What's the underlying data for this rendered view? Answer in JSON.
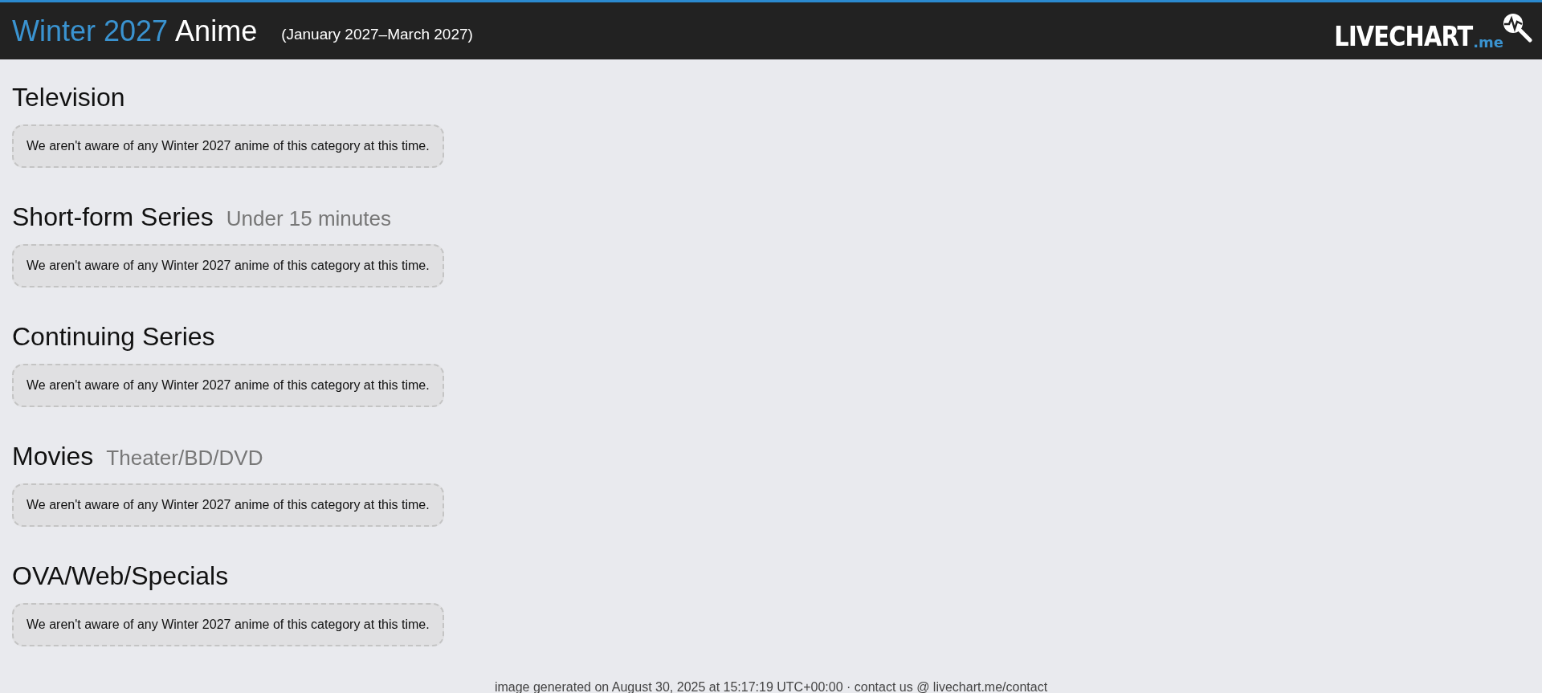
{
  "header": {
    "season": "Winter 2027",
    "title": "Anime",
    "date_range": "(January 2027–March 2027)",
    "logo": {
      "text": "LIVECHART",
      "suffix": ".me"
    }
  },
  "sections": [
    {
      "title": "Television",
      "message": "We aren't aware of any Winter 2027 anime of this category at this time."
    },
    {
      "title": "Short-form Series",
      "subtitle": "Under 15 minutes",
      "message": "We aren't aware of any Winter 2027 anime of this category at this time."
    },
    {
      "title": "Continuing Series",
      "message": "We aren't aware of any Winter 2027 anime of this category at this time."
    },
    {
      "title": "Movies",
      "subtitle": "Theater/BD/DVD",
      "message": "We aren't aware of any Winter 2027 anime of this category at this time."
    },
    {
      "title": "OVA/Web/Specials",
      "message": "We aren't aware of any Winter 2027 anime of this category at this time."
    }
  ],
  "footer": "image generated on August 30, 2025 at 15:17:19 UTC+00:00 · contact us @ livechart.me/contact"
}
